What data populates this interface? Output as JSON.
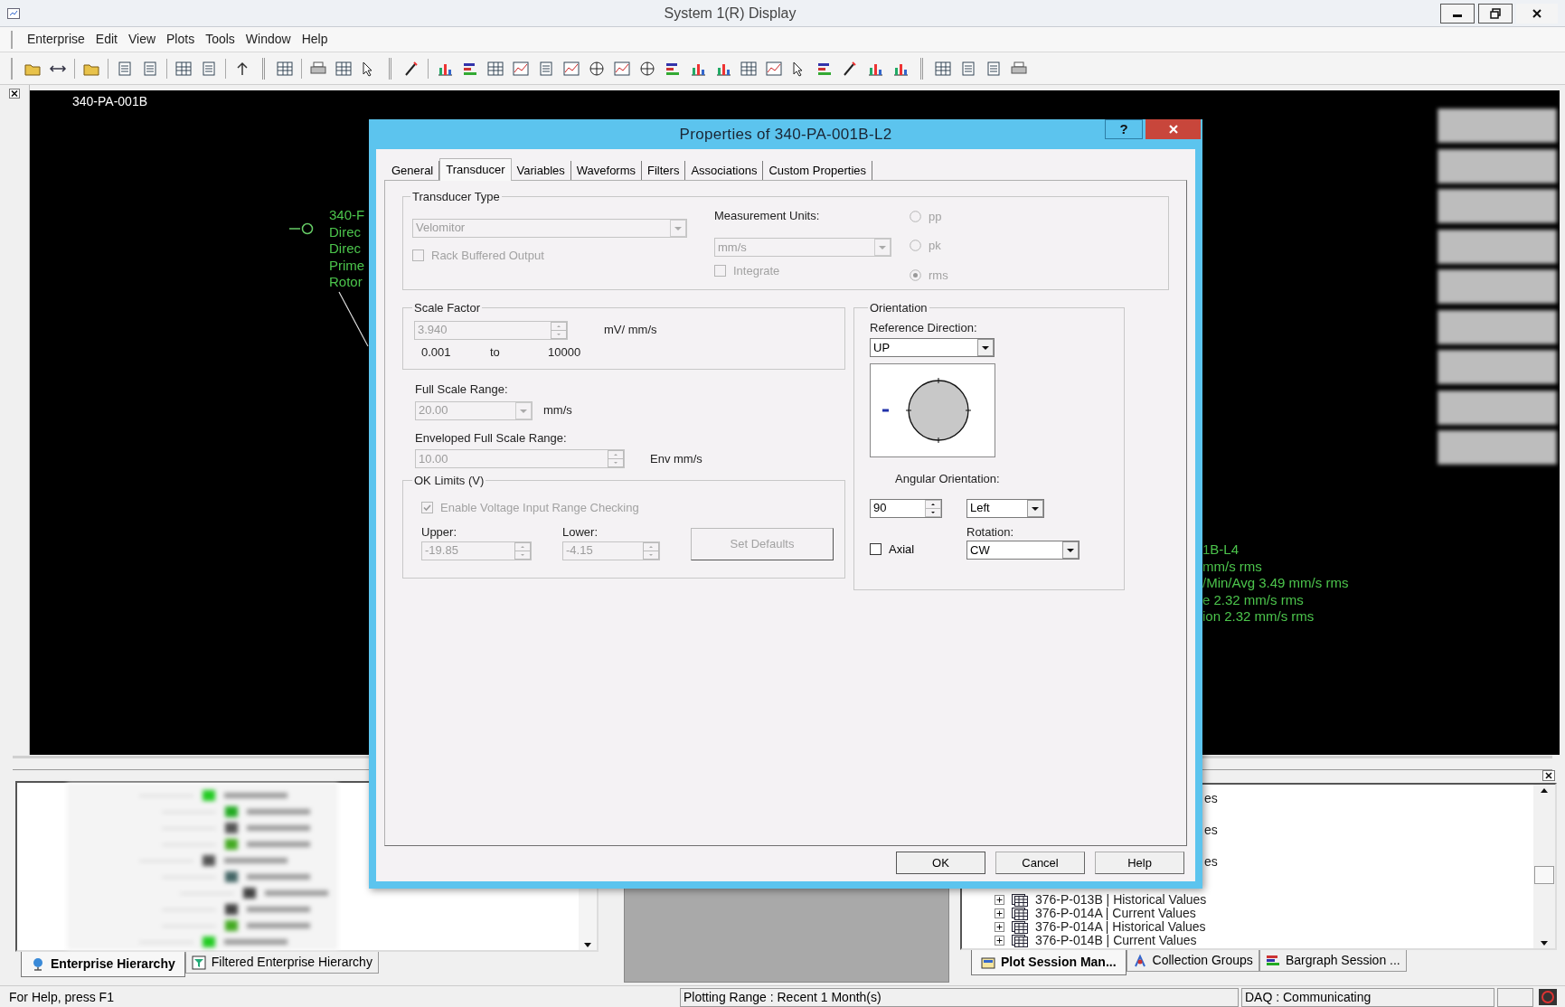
{
  "window": {
    "title": "System 1(R) Display"
  },
  "menu": [
    "Enterprise",
    "Edit",
    "View",
    "Plots",
    "Tools",
    "Window",
    "Help"
  ],
  "display": {
    "title": "340-PA-001B",
    "left_labels": [
      "340-F",
      "Direc",
      "Direc",
      "Prime",
      "Rotor"
    ],
    "right_labels": [
      "1B-L4",
      "mm/s rms",
      "/Min/Avg 3.49 mm/s rms",
      "e 2.32 mm/s rms",
      "ion 2.32 mm/s rms"
    ]
  },
  "dialog": {
    "title": "Properties of 340-PA-001B-L2",
    "help_button": "?",
    "tabs": [
      {
        "label": "General",
        "selected": false
      },
      {
        "label": "Transducer",
        "selected": true
      },
      {
        "label": "Variables",
        "selected": false
      },
      {
        "label": "Waveforms",
        "selected": false
      },
      {
        "label": "Filters",
        "selected": false
      },
      {
        "label": "Associations",
        "selected": false
      },
      {
        "label": "Custom Properties",
        "selected": false
      }
    ],
    "transducer_type": {
      "legend": "Transducer Type",
      "value": "Velomitor",
      "disabled": true
    },
    "rack_buffered_output": {
      "label": "Rack Buffered Output",
      "checked": false,
      "disabled": true
    },
    "measurement_units": {
      "label": "Measurement Units:",
      "value": "mm/s",
      "disabled": true
    },
    "integrate": {
      "label": "Integrate",
      "checked": false,
      "disabled": true
    },
    "amplitude": [
      {
        "label": "pp",
        "selected": false,
        "disabled": true
      },
      {
        "label": "pk",
        "selected": false,
        "disabled": true
      },
      {
        "label": "rms",
        "selected": true,
        "disabled": true
      }
    ],
    "scale_factor": {
      "legend": "Scale Factor",
      "value": "3.940",
      "disabled": true,
      "unit": "mV/ mm/s",
      "min": "0.001",
      "to": "to",
      "max": "10000"
    },
    "full_scale_range": {
      "label": "Full Scale Range:",
      "value": "20.00",
      "disabled": true,
      "unit": "mm/s"
    },
    "enveloped_full_scale_range": {
      "label": "Enveloped Full Scale Range:",
      "value": "10.00",
      "disabled": true,
      "unit": "Env mm/s"
    },
    "ok_limits": {
      "legend": "OK Limits (V)",
      "enable": {
        "label": "Enable Voltage Input Range Checking",
        "checked": true,
        "disabled": true
      },
      "upper_label": "Upper:",
      "upper": "-19.85",
      "lower_label": "Lower:",
      "lower": "-4.15",
      "disabled": true,
      "set_defaults": "Set Defaults"
    },
    "orientation": {
      "legend": "Orientation",
      "reference_label": "Reference Direction:",
      "reference": "UP",
      "angular_label": "Angular Orientation:",
      "angle": "90",
      "side": "Left",
      "axial": {
        "label": "Axial",
        "checked": false,
        "disabled": false
      },
      "rotation_label": "Rotation:",
      "rotation": "CW"
    },
    "buttons": [
      "OK",
      "Cancel",
      "Help"
    ]
  },
  "hierarchy_panel": {
    "tabs": [
      {
        "label": "Enterprise Hierarchy",
        "selected": true
      },
      {
        "label": "Filtered Enterprise Hierarchy",
        "selected": false
      }
    ]
  },
  "session_panel": {
    "partial_rows": [
      "es",
      "es",
      "es"
    ],
    "rows": [
      {
        "label": "376-P-013B | Historical Values",
        "expanded": false
      },
      {
        "label": "376-P-014A | Current Values",
        "expanded": false
      },
      {
        "label": "376-P-014A | Historical Values",
        "expanded": false
      },
      {
        "label": "376-P-014B | Current Values",
        "expanded": false
      }
    ],
    "tabs": [
      {
        "label": "Plot Session Man...",
        "selected": true
      },
      {
        "label": "Collection Groups",
        "selected": false
      },
      {
        "label": "Bargraph Session ...",
        "selected": false
      }
    ]
  },
  "status_bar": [
    "For Help, press F1",
    "Plotting Range : Recent 1 Month(s)",
    "DAQ : Communicating"
  ]
}
